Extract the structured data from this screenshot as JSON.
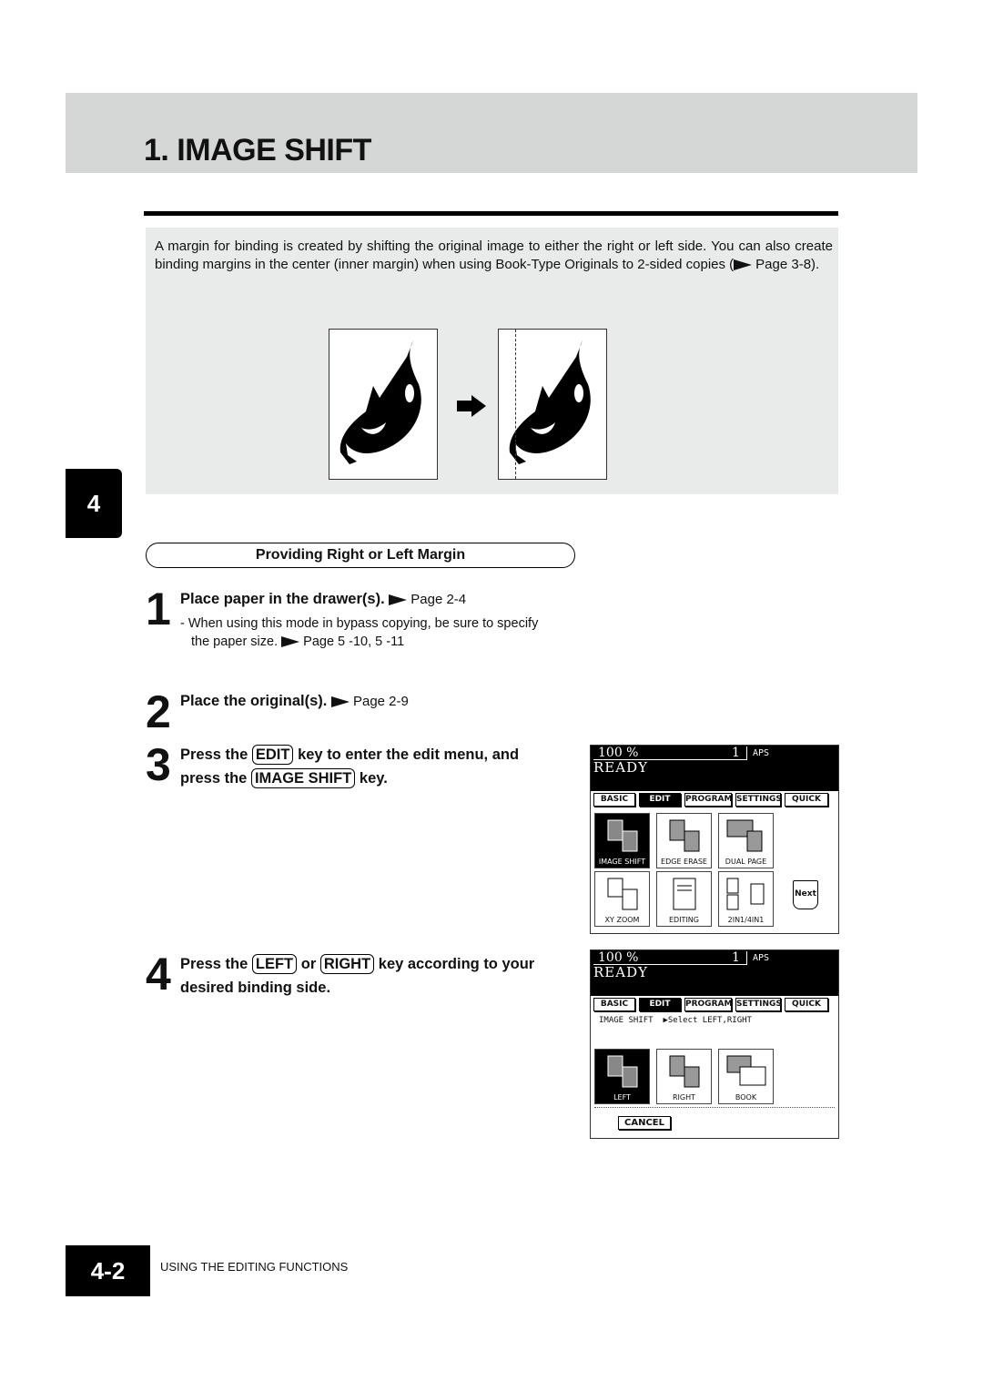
{
  "header": {
    "title": "1. IMAGE SHIFT"
  },
  "intro": {
    "text": "A margin for binding is created by shifting the original image to either the right or left side. You can also create binding margins in the center (inner margin) when using Book-Type Originals to 2-sided copies (",
    "page_ref": "Page 3-8",
    "close": ")."
  },
  "chapter_tab": "4",
  "section": {
    "title": "Providing Right or Left Margin"
  },
  "steps": [
    {
      "num": "1",
      "text": "Place paper in the drawer(s).",
      "ref": "Page 2-4",
      "note": "- When using this mode in bypass copying, be sure to specify",
      "note2": "the paper size.",
      "note_ref": "Page 5 -10, 5 -11"
    },
    {
      "num": "2",
      "text": "Place the original(s).",
      "ref": "Page 2-9"
    },
    {
      "num": "3",
      "pre": "Press the",
      "key1": "EDIT",
      "mid": "key to enter the edit menu, and",
      "line2": "press the",
      "key2": "IMAGE SHIFT",
      "post": "key."
    },
    {
      "num": "4",
      "pre": "Press the",
      "key1": "LEFT",
      "mid": "or",
      "key2": "RIGHT",
      "post": "key according to your",
      "line2": "desired binding side."
    }
  ],
  "panel1": {
    "zoom": "100  %",
    "copies": "1",
    "paper": "APS",
    "status": "READY",
    "tabs": [
      "BASIC",
      "EDIT",
      "PROGRAM",
      "SETTINGS",
      "QUICK"
    ],
    "buttons": [
      "IMAGE SHIFT",
      "EDGE ERASE",
      "DUAL PAGE",
      "XY ZOOM",
      "EDITING",
      "2IN1/4IN1"
    ],
    "next": "Next"
  },
  "panel2": {
    "zoom": "100  %",
    "copies": "1",
    "paper": "APS",
    "status": "READY",
    "tabs": [
      "BASIC",
      "EDIT",
      "PROGRAM",
      "SETTINGS",
      "QUICK"
    ],
    "message": "IMAGE SHIFT  ▶Select LEFT,RIGHT",
    "buttons": [
      "LEFT",
      "RIGHT",
      "BOOK"
    ],
    "cancel": "CANCEL"
  },
  "footer": {
    "page": "4-2",
    "section": "USING THE EDITING FUNCTIONS"
  }
}
